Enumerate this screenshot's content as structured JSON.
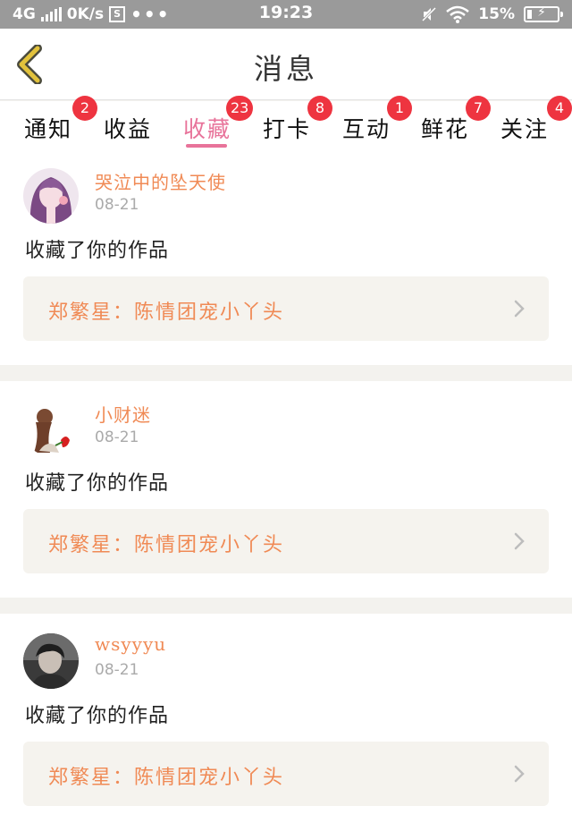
{
  "status_bar": {
    "network": "4G",
    "speed": "0K/s",
    "sim_label": "S",
    "more": "•••",
    "time": "19:23",
    "battery": "15%",
    "battery_level": 0.15
  },
  "header": {
    "title": "消息",
    "back_icon": "chevron-left-icon",
    "back_color": "#e2c23c"
  },
  "tabs": [
    {
      "label": "通知",
      "badge": "2"
    },
    {
      "label": "收益",
      "badge": ""
    },
    {
      "label": "收藏",
      "badge": "23",
      "active": true
    },
    {
      "label": "打卡",
      "badge": "8"
    },
    {
      "label": "互动",
      "badge": "1"
    },
    {
      "label": "鲜花",
      "badge": "7"
    },
    {
      "label": "关注",
      "badge": "4"
    }
  ],
  "notifications": [
    {
      "username": "哭泣中的坠天使",
      "date": "08-21",
      "action": "收藏了你的作品",
      "work_title": "郑繁星：陈情团宠小丫头"
    },
    {
      "username": "小财迷",
      "date": "08-21",
      "action": "收藏了你的作品",
      "work_title": "郑繁星：陈情团宠小丫头"
    },
    {
      "username": "wsyyyu",
      "date": "08-21",
      "action": "收藏了你的作品",
      "work_title": "郑繁星：陈情团宠小丫头"
    }
  ],
  "colors": {
    "accent": "#e8739a",
    "badge": "#ee3440",
    "username": "#f08a55",
    "work_title": "#f08a55"
  }
}
